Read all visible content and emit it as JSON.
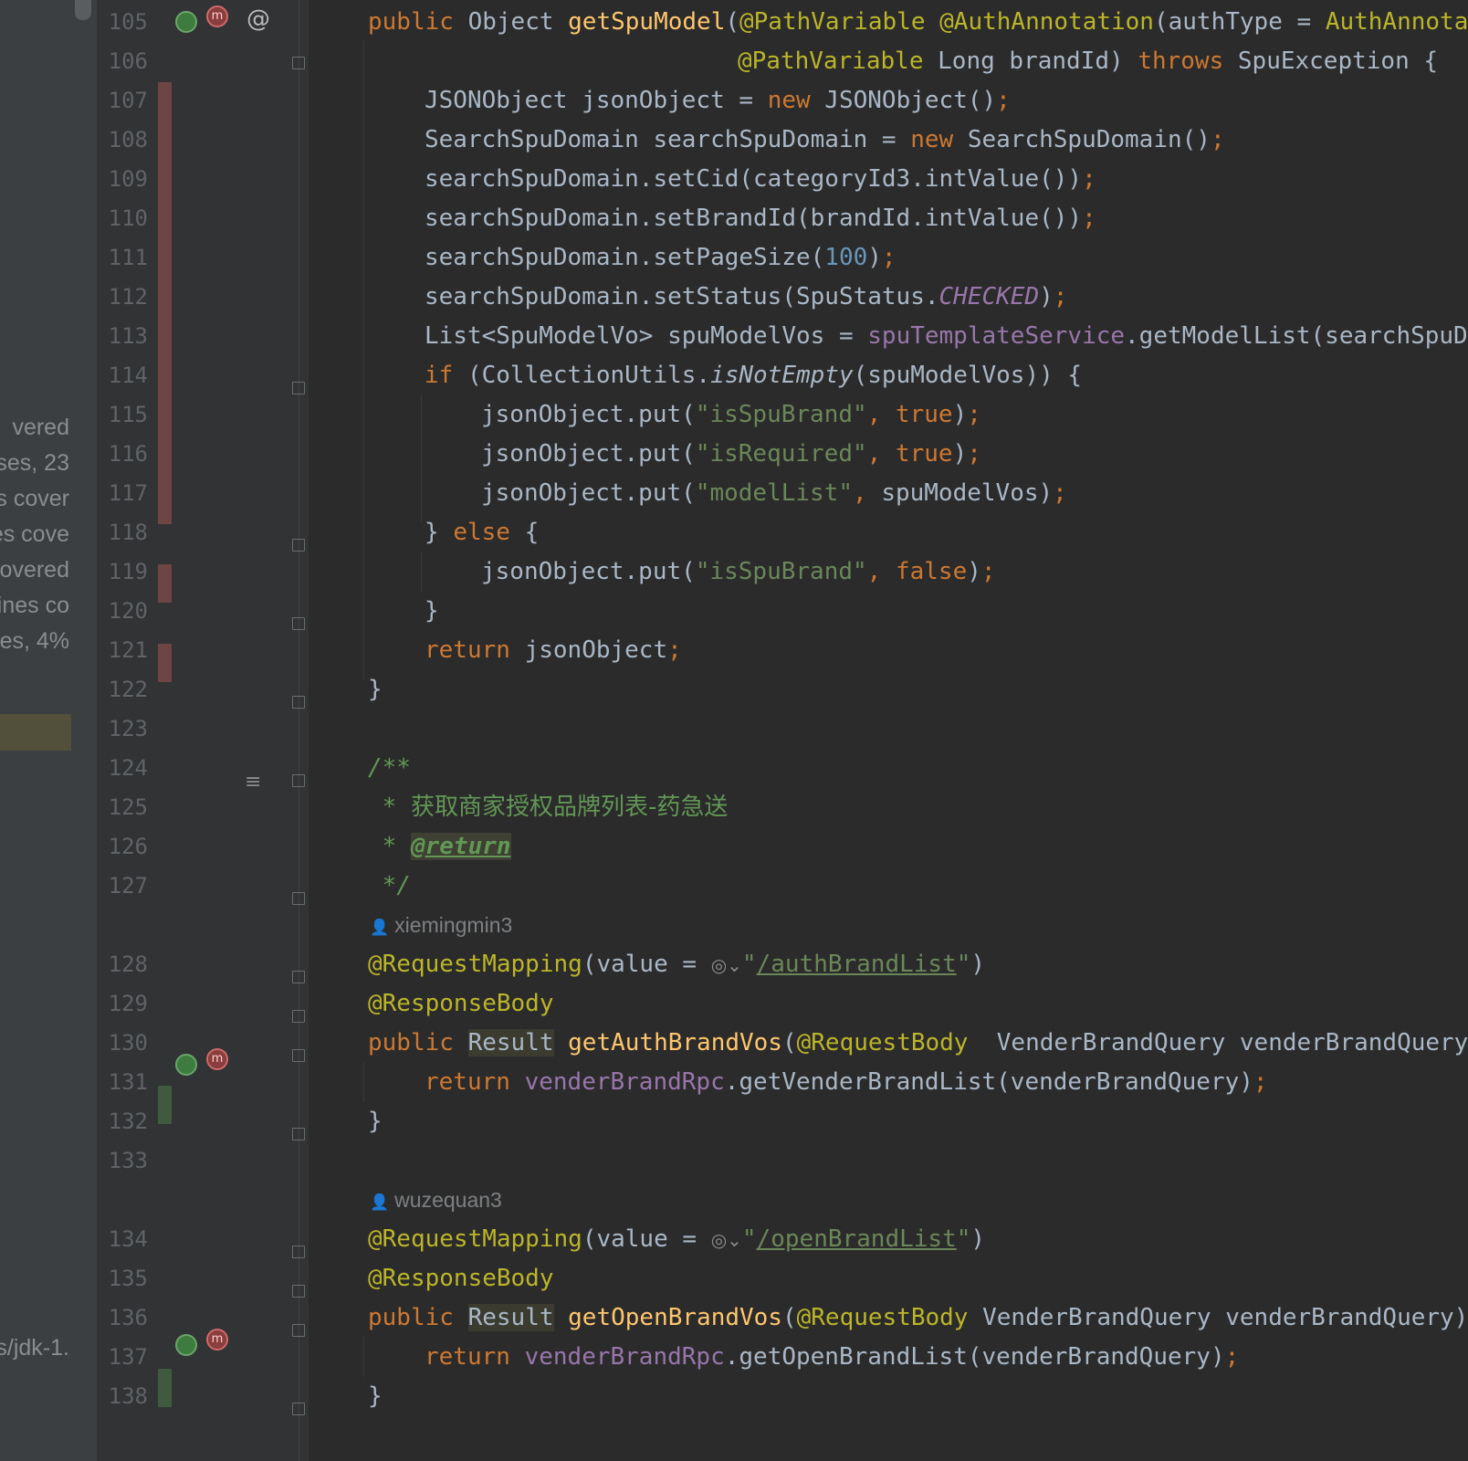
{
  "side_panel": {
    "items": [
      "vered",
      "ses, 23",
      "s cover",
      "es cove",
      "covered",
      "ines co",
      "es, 4%"
    ],
    "jdk": "s/jdk-1."
  },
  "lines": [
    {
      "n": "105"
    },
    {
      "n": "106"
    },
    {
      "n": "107"
    },
    {
      "n": "108"
    },
    {
      "n": "109"
    },
    {
      "n": "110"
    },
    {
      "n": "111"
    },
    {
      "n": "112"
    },
    {
      "n": "113"
    },
    {
      "n": "114"
    },
    {
      "n": "115"
    },
    {
      "n": "116"
    },
    {
      "n": "117"
    },
    {
      "n": "118"
    },
    {
      "n": "119"
    },
    {
      "n": "120"
    },
    {
      "n": "121"
    },
    {
      "n": "122"
    },
    {
      "n": "123"
    },
    {
      "n": "124"
    },
    {
      "n": "125"
    },
    {
      "n": "126"
    },
    {
      "n": "127"
    },
    {
      "n": "128"
    },
    {
      "n": "129"
    },
    {
      "n": "130"
    },
    {
      "n": "131"
    },
    {
      "n": "132"
    },
    {
      "n": "133"
    },
    {
      "n": "134"
    },
    {
      "n": "135"
    },
    {
      "n": "136"
    },
    {
      "n": "137"
    },
    {
      "n": "138"
    }
  ],
  "code": {
    "l105": {
      "a": "public",
      "b": " Object ",
      "c": "getSpuModel",
      "d": "(",
      "e": "@PathVariable",
      "f": " ",
      "g": "@AuthAnnotation",
      "h": "(authType = ",
      "i": "AuthAnnota"
    },
    "l106": {
      "a": "@PathVariable",
      "b": " Long brandId) ",
      "c": "throws",
      "d": " SpuException {"
    },
    "l107": {
      "a": "JSONObject jsonObject = ",
      "b": "new",
      "c": " JSONObject()",
      "d": ";"
    },
    "l108": {
      "a": "SearchSpuDomain searchSpuDomain = ",
      "b": "new",
      "c": " SearchSpuDomain()",
      "d": ";"
    },
    "l109": {
      "a": "searchSpuDomain.setCid(categoryId3.intValue())",
      "b": ";"
    },
    "l110": {
      "a": "searchSpuDomain.setBrandId(brandId.intValue())",
      "b": ";"
    },
    "l111": {
      "a": "searchSpuDomain.setPageSize(",
      "b": "100",
      "c": ")",
      "d": ";"
    },
    "l112": {
      "a": "searchSpuDomain.setStatus(SpuStatus.",
      "b": "CHECKED",
      "c": ")",
      "d": ";"
    },
    "l113": {
      "a": "List<SpuModelVo> spuModelVos = ",
      "b": "spuTemplateService",
      "c": ".getModelList(searchSpuDo"
    },
    "l114": {
      "a": "if",
      "b": " (CollectionUtils.",
      "c": "isNotEmpty",
      "d": "(spuModelVos)) {"
    },
    "l115": {
      "a": "jsonObject.put(",
      "b": "\"isSpuBrand\"",
      "c": ", ",
      "d": "true",
      "e": ")",
      "f": ";"
    },
    "l116": {
      "a": "jsonObject.put(",
      "b": "\"isRequired\"",
      "c": ", ",
      "d": "true",
      "e": ")",
      "f": ";"
    },
    "l117": {
      "a": "jsonObject.put(",
      "b": "\"modelList\"",
      "c": ", ",
      "d": "spuModelVos)",
      "e": ";"
    },
    "l118": {
      "a": "} ",
      "b": "else",
      "c": " {"
    },
    "l119": {
      "a": "jsonObject.put(",
      "b": "\"isSpuBrand\"",
      "c": ", ",
      "d": "false",
      "e": ")",
      "f": ";"
    },
    "l120": {
      "a": "}"
    },
    "l121": {
      "a": "return",
      "b": " jsonObject",
      "c": ";"
    },
    "l122": {
      "a": "}"
    },
    "l124": {
      "a": "/**"
    },
    "l125": {
      "a": " * ",
      "b": "获取商家授权品牌列表-药急送"
    },
    "l126": {
      "a": " * ",
      "b": "@return"
    },
    "l127": {
      "a": " */"
    },
    "author1": "xiemingmin3",
    "l128": {
      "a": "@RequestMapping",
      "b": "(value = ",
      "c": "\"",
      "d": "/authBrandList",
      "e": "\"",
      "f": ")"
    },
    "l129": {
      "a": "@ResponseBody"
    },
    "l130": {
      "a": "public",
      "b": " ",
      "c": "Result",
      "d": " ",
      "e": "getAuthBrandVos",
      "f": "(",
      "g": "@RequestBody",
      "h": "  VenderBrandQuery venderBrandQuery)"
    },
    "l131": {
      "a": "return",
      "b": " ",
      "c": "venderBrandRpc",
      "d": ".getVenderBrandList(venderBrandQuery)",
      "e": ";"
    },
    "l132": {
      "a": "}"
    },
    "author2": "wuzequan3",
    "l134": {
      "a": "@RequestMapping",
      "b": "(value = ",
      "c": "\"",
      "d": "/openBrandList",
      "e": "\"",
      "f": ")"
    },
    "l135": {
      "a": "@ResponseBody"
    },
    "l136": {
      "a": "public",
      "b": " ",
      "c": "Result",
      "d": " ",
      "e": "getOpenBrandVos",
      "f": "(",
      "g": "@RequestBody",
      "h": " VenderBrandQuery venderBrandQuery)"
    },
    "l137": {
      "a": "return",
      "b": " ",
      "c": "venderBrandRpc",
      "d": ".getOpenBrandList(venderBrandQuery)",
      "e": ";"
    },
    "l138": {
      "a": "}"
    }
  },
  "icons": {
    "web_endpoint": "globe-icon",
    "method_marker": "m-badge-icon",
    "override": "at-icon",
    "doc_render": "render-doc-icon",
    "person": "person-icon",
    "url_globe": "globe-dropdown-icon"
  },
  "colors": {
    "background": "#2b2b2b",
    "gutter": "#313335",
    "keyword": "#cc7832",
    "annotation": "#bbb529",
    "method": "#ffc66d",
    "string": "#6a8759",
    "number": "#6897bb",
    "field": "#9876aa",
    "comment": "#629755",
    "coverage_red": "#6e4444",
    "coverage_green": "#3f5a3f"
  }
}
